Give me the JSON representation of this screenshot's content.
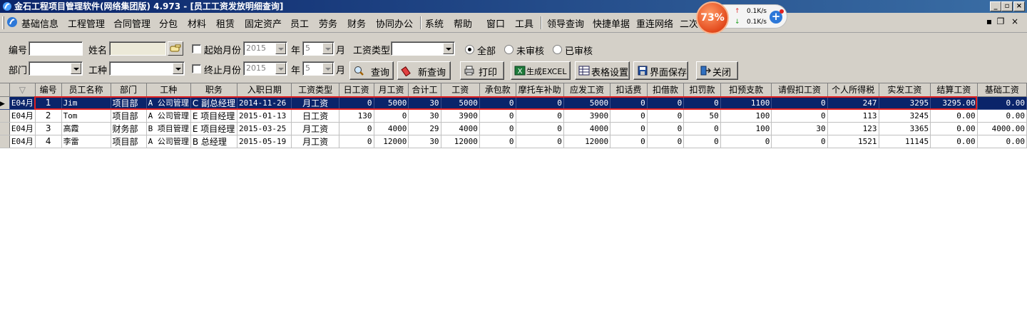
{
  "window": {
    "title": "金石工程项目管理软件(网络集团版) 4.973 - [员工工资发放明细查询]"
  },
  "menu": [
    "基础信息",
    "工程管理",
    "合同管理",
    "分包",
    "材料",
    "租赁",
    "固定资产",
    "员工",
    "劳务",
    "财务",
    "协同办公",
    "系统",
    "帮助",
    "窗口",
    "工具",
    "领导查询",
    "快捷单据",
    "重连网络",
    "二次"
  ],
  "net_widget": {
    "percent": "73%",
    "up": "0.1K/s",
    "down": "0.1K/s"
  },
  "filters": {
    "code_label": "编号",
    "name_label": "姓名",
    "start_month_label": "起始月份",
    "end_month_label": "终止月份",
    "year_label": "年",
    "month_label": "月",
    "wage_type_label": "工资类型",
    "dept_label": "部门",
    "worktype_label": "工种",
    "start_year": "2015",
    "start_month": "5",
    "end_year": "2015",
    "end_month": "5",
    "radio_all": "全部",
    "radio_unaudited": "未审核",
    "radio_audited": "已审核"
  },
  "buttons": {
    "query": "查询",
    "new_query": "新查询",
    "print": "打印",
    "excel": "生成EXCEL",
    "table_settings": "表格设置",
    "save_layout": "界面保存",
    "close": "关闭"
  },
  "table": {
    "columns": [
      "",
      "编号",
      "员工名称",
      "部门",
      "工种",
      "职务",
      "入职日期",
      "工资类型",
      "日工资",
      "月工资",
      "合计工",
      "工资",
      "承包款",
      "摩托车补助",
      "应发工资",
      "扣话费",
      "扣借款",
      "扣罚款",
      "扣预支款",
      "请假扣工资",
      "个人所得税",
      "实发工资",
      "结算工资",
      "基础工资"
    ],
    "rows": [
      [
        "E04月",
        "1",
        "Jim",
        "项目部",
        "A 公司管理",
        "C 副总经理",
        "2014-11-26",
        "月工资",
        "0",
        "5000",
        "30",
        "5000",
        "0",
        "0",
        "5000",
        "0",
        "0",
        "0",
        "1100",
        "0",
        "247",
        "3295",
        "3295.00",
        "0.00"
      ],
      [
        "E04月",
        "2",
        "Tom",
        "项目部",
        "A 公司管理",
        "E 项目经理",
        "2015-01-13",
        "日工资",
        "130",
        "0",
        "30",
        "3900",
        "0",
        "0",
        "3900",
        "0",
        "0",
        "50",
        "100",
        "0",
        "113",
        "3245",
        "0.00",
        "0.00"
      ],
      [
        "E04月",
        "3",
        "高霞",
        "财务部",
        "B 项目管理",
        "E 项目经理",
        "2015-03-25",
        "月工资",
        "0",
        "4000",
        "29",
        "4000",
        "0",
        "0",
        "4000",
        "0",
        "0",
        "0",
        "100",
        "30",
        "123",
        "3365",
        "0.00",
        "4000.00"
      ],
      [
        "E04月",
        "4",
        "李雷",
        "项目部",
        "A 公司管理",
        "B 总经理",
        "2015-05-19",
        "月工资",
        "0",
        "12000",
        "30",
        "12000",
        "0",
        "0",
        "12000",
        "0",
        "0",
        "0",
        "0",
        "0",
        "1521",
        "11145",
        "0.00",
        "0.00"
      ]
    ]
  }
}
